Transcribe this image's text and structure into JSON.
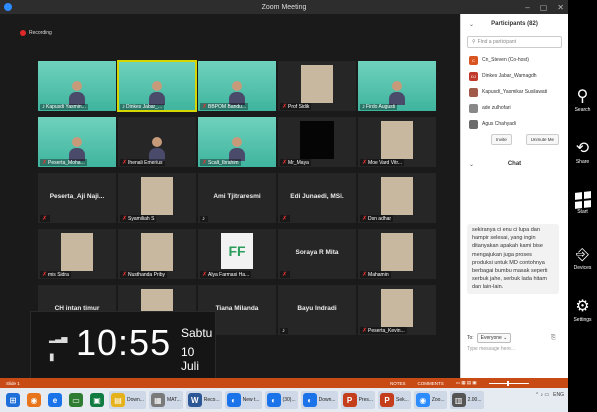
{
  "window": {
    "title": "Zoom Meeting",
    "controls": [
      "–",
      "▢",
      "✕"
    ]
  },
  "recording_label": "Recording",
  "grid": [
    {
      "name": "Kapusdi Yasmin...",
      "style": "green",
      "mic_muted": false
    },
    {
      "name": "Dinkes Jabar_...",
      "style": "green",
      "mic_muted": false,
      "active": true
    },
    {
      "name": "BBPOM Bandu...",
      "style": "green",
      "mic_muted": true
    },
    {
      "name": "Prof Sidik",
      "style": "photo",
      "mic_muted": true
    },
    {
      "name": "Firdo Augusti",
      "style": "green",
      "mic_muted": false
    },
    {
      "name": "Peserta_Moha...",
      "style": "green",
      "mic_muted": true
    },
    {
      "name": "Ihenali Emerius",
      "style": "person",
      "mic_muted": true
    },
    {
      "name": "Scalt_Ibrahim",
      "style": "green",
      "mic_muted": true
    },
    {
      "name": "Mr_Maya",
      "style": "black",
      "mic_muted": true
    },
    {
      "name": "Moe Vard Vitr...",
      "style": "photo",
      "mic_muted": true
    },
    {
      "name": "",
      "bigname": "Peserta_Aji Naji...",
      "style": "name",
      "mic_muted": true
    },
    {
      "name": "Syamiliah S",
      "style": "photo",
      "mic_muted": true
    },
    {
      "name": "",
      "bigname": "Ami Tjitraresmi",
      "style": "name",
      "mic_muted": false
    },
    {
      "name": "",
      "bigname": "Edi Junaedi, MSi.",
      "style": "name",
      "mic_muted": true
    },
    {
      "name": "Dsn adhar",
      "style": "photo",
      "mic_muted": true
    },
    {
      "name": "mis Sidra",
      "style": "photo",
      "mic_muted": true
    },
    {
      "name": "Nusthanda Priby",
      "style": "photo",
      "mic_muted": true
    },
    {
      "name": "Alya Farmasi Ha...",
      "style": "logo",
      "mic_muted": true
    },
    {
      "name": "",
      "bigname": "Soraya R Mita",
      "style": "name",
      "mic_muted": true
    },
    {
      "name": "Mahamin",
      "style": "photo",
      "mic_muted": true
    },
    {
      "name": "",
      "bigname": "CH intan timur",
      "style": "name",
      "mic_muted": true
    },
    {
      "name": "",
      "style": "photo",
      "mic_muted": true
    },
    {
      "name": "",
      "bigname": "Tiana Milanda",
      "style": "name",
      "mic_muted": true
    },
    {
      "name": "",
      "bigname": "Bayu Indradi",
      "style": "name",
      "mic_muted": false
    },
    {
      "name": "Peserta_Kevin...",
      "style": "photo",
      "mic_muted": true
    }
  ],
  "clock": {
    "time": "10:55",
    "day": "Sabtu",
    "date": "10 Juli"
  },
  "participants": {
    "title": "Participants (82)",
    "search_placeholder": "Find a participant",
    "items": [
      {
        "initials": "C",
        "name": "Cn_Steven (Co-host)",
        "color": "#d9531e"
      },
      {
        "initials": "DJ",
        "name": "Dinkes Jabar_Wamagdh",
        "color": "#c0392b"
      },
      {
        "initials": "",
        "name": "Kapusdi_Yasmikar Susilawati",
        "color": "#a05a4a"
      },
      {
        "initials": "",
        "name": "ade zulhofari",
        "color": "#888888"
      },
      {
        "initials": "",
        "name": "Agus Chahyadi",
        "color": "#6b6b6b"
      }
    ],
    "invite_label": "Invite",
    "unmute_label": "Unmute Me"
  },
  "chat": {
    "title": "Chat",
    "message": "sekiranya ci enu ci lupa dan hampir selesai, yang ingin ditanyakan apakah kami bise mengajukan juga proses produksi untuk MD contohnya berbagai bumbu masak seperti serbuk jahe, serbuk lada hitam dan lain-lain.",
    "to_label": "To:",
    "to_value": "Everyone",
    "input_placeholder": "Type message here..."
  },
  "charms": [
    {
      "icon": "search-icon",
      "label": "Search",
      "glyph": "⚲"
    },
    {
      "icon": "share-icon",
      "label": "Share",
      "glyph": "⟲"
    },
    {
      "icon": "windows-icon",
      "label": "Start",
      "glyph": ""
    },
    {
      "icon": "devices-icon",
      "label": "Devices",
      "glyph": "⎆"
    },
    {
      "icon": "settings-icon",
      "label": "Settings",
      "glyph": "⚙"
    }
  ],
  "statusbar": {
    "left": "Slide 1",
    "notes": "NOTES",
    "comments": "COMMENTS"
  },
  "taskbar": [
    {
      "label": "",
      "color": "#1e6fd9",
      "glyph": "⊞"
    },
    {
      "label": "",
      "color": "#e8741c",
      "glyph": "◉"
    },
    {
      "label": "",
      "color": "#1a73e8",
      "glyph": "e"
    },
    {
      "label": "",
      "color": "#2e7d32",
      "glyph": "▭"
    },
    {
      "label": "",
      "color": "#107c41",
      "glyph": "▣"
    },
    {
      "label": "Down...",
      "color": "#e5b21b",
      "glyph": "▤"
    },
    {
      "label": "MAT...",
      "color": "#7a7a7a",
      "glyph": "▦"
    },
    {
      "label": "Reco...",
      "color": "#2b5797",
      "glyph": "W"
    },
    {
      "label": "New t...",
      "color": "#1a73e8",
      "glyph": "◐"
    },
    {
      "label": "(30)...",
      "color": "#1a73e8",
      "glyph": "◐"
    },
    {
      "label": "Down...",
      "color": "#1a73e8",
      "glyph": "◐"
    },
    {
      "label": "Pres...",
      "color": "#c43e1c",
      "glyph": "P"
    },
    {
      "label": "Sek...",
      "color": "#c43e1c",
      "glyph": "P"
    },
    {
      "label": "Zoo...",
      "color": "#2d8cff",
      "glyph": "◉"
    },
    {
      "label": "2.00...",
      "color": "#555555",
      "glyph": "▥"
    }
  ],
  "tray": {
    "lang": "ENG",
    "time": "10:55"
  }
}
